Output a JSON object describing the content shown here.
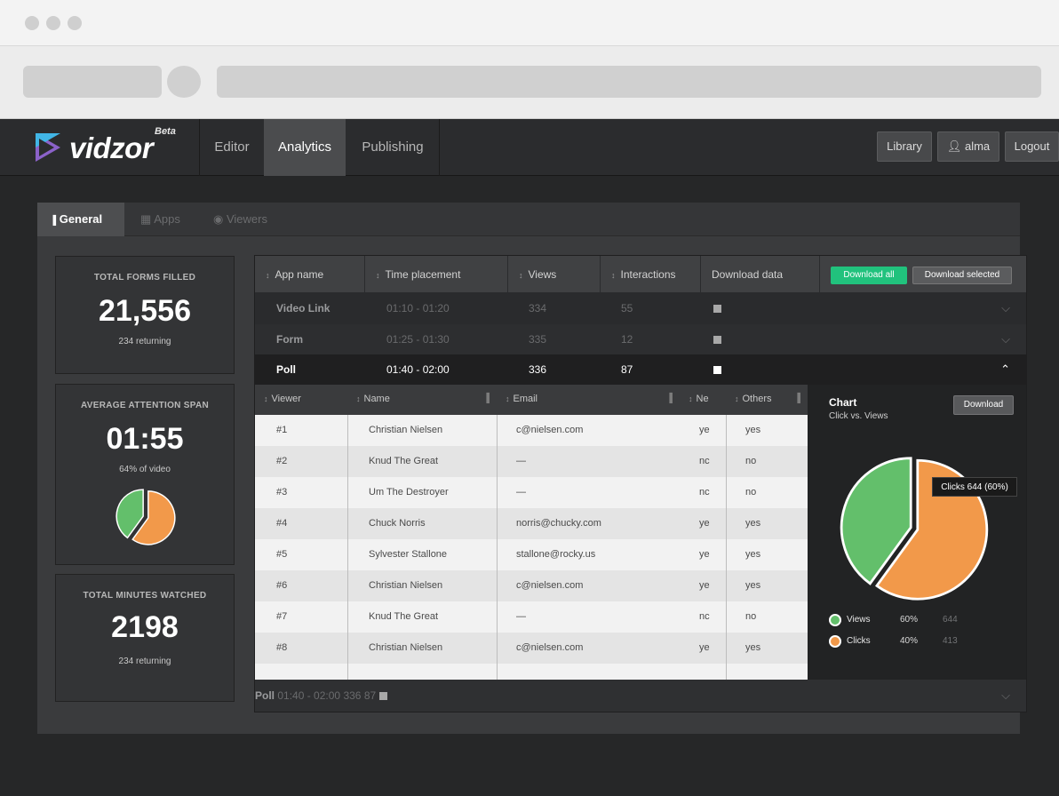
{
  "app": {
    "logo_text": "vidzor",
    "logo_badge": "Beta",
    "nav_tabs": [
      "Editor",
      "Analytics",
      "Publishing"
    ],
    "active_nav": "Analytics",
    "right_buttons": {
      "library": "Library",
      "user": "alma",
      "logout": "Logout"
    }
  },
  "subtabs": [
    "General",
    "Apps",
    "Viewers"
  ],
  "stats": [
    {
      "label": "TOTAL FORMS FILLED",
      "value": "21,556",
      "sub": "234 returning"
    },
    {
      "label": "AVERAGE ATTENTION SPAN",
      "value": "01:55",
      "sub": "64% of video"
    },
    {
      "label": "TOTAL MINUTES WATCHED",
      "value": "2198",
      "sub": "234 returning"
    }
  ],
  "apps_table": {
    "columns": [
      "App name",
      "Time placement",
      "Views",
      "Interactions",
      "Download data"
    ],
    "download_all": "Download all",
    "download_selected": "Download selected",
    "rows": [
      {
        "name": "Video Link",
        "time": "01:10 - 01:20",
        "views": "334",
        "interactions": "55"
      },
      {
        "name": "Form",
        "time": "01:25 - 01:30",
        "views": "335",
        "interactions": "12"
      },
      {
        "name": "Poll",
        "time": "01:40 - 02:00",
        "views": "336",
        "interactions": "87"
      }
    ],
    "last_row": {
      "name": "Poll",
      "time": "01:40 - 02:00",
      "views": "336",
      "interactions": "87"
    }
  },
  "viewers_table": {
    "columns": [
      "Viewer",
      "Name",
      "Email",
      "Ne",
      "Others"
    ],
    "rows": [
      {
        "viewer": "#1",
        "name": "Christian Nielsen",
        "email": "c@nielsen.com",
        "ne": "ye",
        "others": "yes"
      },
      {
        "viewer": "#2",
        "name": "Knud The Great",
        "email": "—",
        "ne": "nc",
        "others": "no"
      },
      {
        "viewer": "#3",
        "name": "Um The Destroyer",
        "email": "—",
        "ne": "nc",
        "others": "no"
      },
      {
        "viewer": "#4",
        "name": "Chuck Norris",
        "email": "norris@chucky.com",
        "ne": "ye",
        "others": "yes"
      },
      {
        "viewer": "#5",
        "name": "Sylvester Stallone",
        "email": "stallone@rocky.us",
        "ne": "ye",
        "others": "yes"
      },
      {
        "viewer": "#6",
        "name": "Christian Nielsen",
        "email": "c@nielsen.com",
        "ne": "ye",
        "others": "yes"
      },
      {
        "viewer": "#7",
        "name": "Knud The Great",
        "email": "—",
        "ne": "nc",
        "others": "no"
      },
      {
        "viewer": "#8",
        "name": "Christian Nielsen",
        "email": "c@nielsen.com",
        "ne": "ye",
        "others": "yes"
      }
    ]
  },
  "chart_panel": {
    "title": "Chart",
    "subtitle": "Click vs. Views",
    "download_label": "Download",
    "tooltip": "Clicks 644 (60%)",
    "legend": [
      {
        "label": "Views",
        "percent": "60%",
        "count": "644",
        "color": "#63bf6b"
      },
      {
        "label": "Clicks",
        "percent": "40%",
        "count": "413",
        "color": "#f2994a"
      }
    ]
  },
  "chart_data": [
    {
      "type": "pie",
      "values": [
        40,
        60
      ],
      "colors": [
        "#63bf6b",
        "#f2994a"
      ]
    },
    {
      "type": "pie",
      "categories": [
        "Views",
        "Clicks"
      ],
      "values": [
        40,
        60
      ],
      "colors": [
        "#63bf6b",
        "#f2994a"
      ]
    }
  ]
}
